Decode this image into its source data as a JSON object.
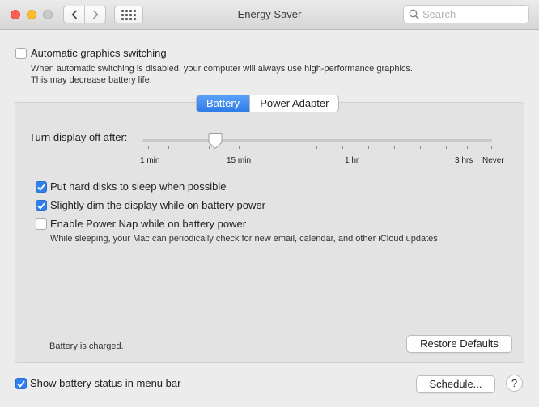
{
  "window": {
    "title": "Energy Saver"
  },
  "toolbar": {
    "back_glyph": "‹",
    "forward_glyph": "›",
    "grid_icon": "grid-icon",
    "search_placeholder": "Search"
  },
  "graphics": {
    "label": "Automatic graphics switching",
    "checked": false,
    "description_line1": "When automatic switching is disabled, your computer will always use high-performance graphics.",
    "description_line2": "This may decrease battery life."
  },
  "tabs": [
    {
      "label": "Battery",
      "active": true
    },
    {
      "label": "Power Adapter",
      "active": false
    }
  ],
  "display_sleep": {
    "label": "Turn display off after:",
    "selected": "15 min",
    "ticks": {
      "one_min": "1 min",
      "fifteen_min": "15 min",
      "one_hr": "1 hr",
      "three_hrs": "3 hrs",
      "never": "Never"
    }
  },
  "options": {
    "hard_disks": {
      "label": "Put hard disks to sleep when possible",
      "checked": true
    },
    "dim_display": {
      "label": "Slightly dim the display while on battery power",
      "checked": true
    },
    "power_nap": {
      "label": "Enable Power Nap while on battery power",
      "checked": false,
      "description": "While sleeping, your Mac can periodically check for new email, calendar, and other iCloud updates"
    }
  },
  "status": {
    "battery": "Battery is charged."
  },
  "buttons": {
    "restore_defaults": "Restore Defaults",
    "schedule": "Schedule...",
    "help": "?"
  },
  "menu_bar_option": {
    "label": "Show battery status in menu bar",
    "checked": true
  },
  "colors": {
    "accent": "#2f80ed",
    "close": "#fd5f57",
    "minimize": "#febc2e"
  }
}
